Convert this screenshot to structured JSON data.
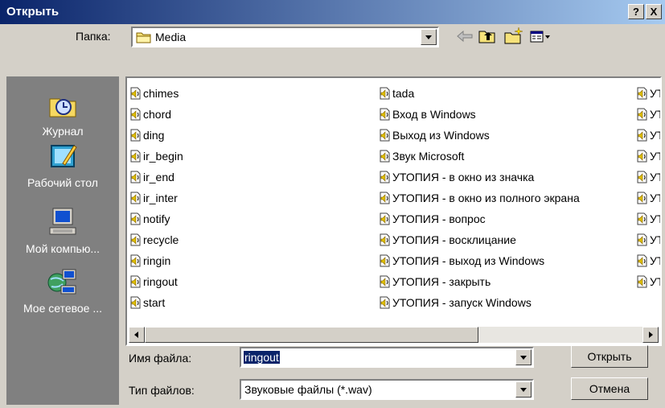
{
  "window": {
    "title": "Открыть",
    "help_label": "?",
    "close_label": "X"
  },
  "toolbar": {
    "folder_label": "Папка:",
    "folder_value": "Media"
  },
  "places": [
    {
      "label": "Журнал",
      "icon": "history-icon"
    },
    {
      "label": "Рабочий стол",
      "icon": "desktop-icon"
    },
    {
      "label": "Мой компью...",
      "icon": "my-computer-icon"
    },
    {
      "label": "Мое сетевое ...",
      "icon": "network-places-icon"
    }
  ],
  "files": {
    "col1": [
      "chimes",
      "chord",
      "ding",
      "ir_begin",
      "ir_end",
      "ir_inter",
      "notify",
      "recycle",
      "ringin",
      "ringout",
      "start"
    ],
    "col2": [
      "tada",
      "Вход в Windows",
      "Выход из Windows",
      "Звук Microsoft",
      "УТОПИЯ - в окно из значка",
      "УТОПИЯ - в окно из полного экрана",
      "УТОПИЯ - вопрос",
      "УТОПИЯ - восклицание",
      "УТОПИЯ - выход из Windows",
      "УТОПИЯ - закрыть",
      "УТОПИЯ - запуск Windows"
    ],
    "col3": [
      "УТ",
      "УТ",
      "УТ",
      "УТ",
      "УТ",
      "УТ",
      "УТ",
      "УТ",
      "УТ",
      "УТ"
    ]
  },
  "form": {
    "filename_label": "Имя файла:",
    "filename_value": "ringout",
    "filetype_label": "Тип файлов:",
    "filetype_value": "Звуковые файлы (*.wav)"
  },
  "buttons": {
    "open": "Открыть",
    "cancel": "Отмена"
  },
  "colors": {
    "title_start": "#0a246a",
    "title_end": "#a6caf0",
    "selection": "#0a246a",
    "face": "#d4d0c8"
  }
}
